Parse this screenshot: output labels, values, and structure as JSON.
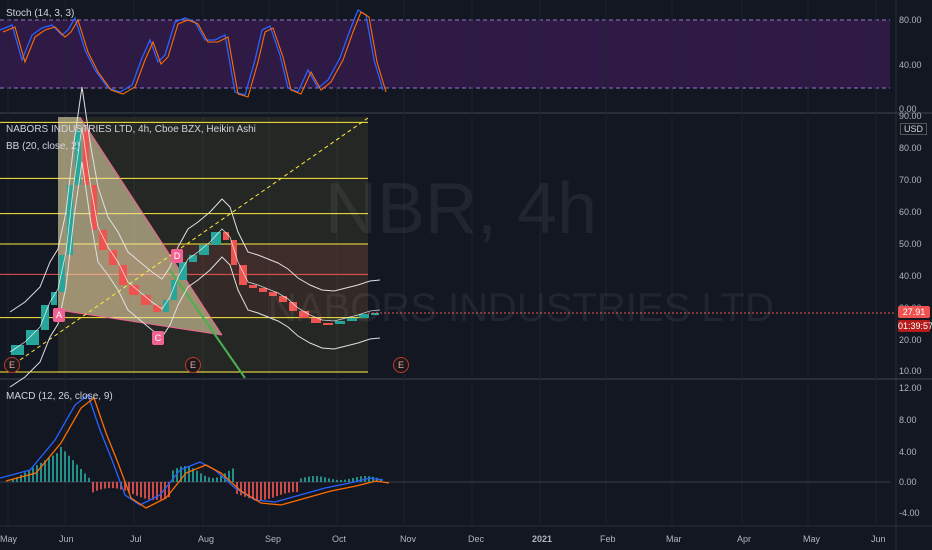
{
  "stoch": {
    "label": "Stoch (14, 3, 3)",
    "axis": [
      "80.00",
      "40.00",
      "0.00"
    ]
  },
  "main": {
    "title": "NABORS INDUSTRIES LTD, 4h, Cboe BZX, Heikin Ashi",
    "bb_label": "BB (20, close, 2)",
    "watermark_symbol": "NBR, 4h",
    "watermark_name": "NABORS INDUSTRIES LTD",
    "currency": "USD",
    "axis": [
      "90.00",
      "80.00",
      "70.00",
      "60.00",
      "50.00",
      "40.00",
      "30.00",
      "20.00",
      "10.00"
    ],
    "last_price": "27.91",
    "countdown": "01:39:57",
    "pattern_points": [
      "A",
      "C",
      "D"
    ],
    "event_markers": [
      "E",
      "E",
      "E"
    ]
  },
  "macd": {
    "label": "MACD (12, 26, close, 9)",
    "axis": [
      "12.00",
      "8.00",
      "4.00",
      "0.00",
      "-4.00"
    ]
  },
  "time_axis": [
    "May",
    "Jun",
    "Jul",
    "Aug",
    "Sep",
    "Oct",
    "Nov",
    "Dec",
    "2021",
    "Feb",
    "Mar",
    "Apr",
    "May",
    "Jun"
  ],
  "colors": {
    "background": "#131722",
    "up_candle": "#26a69a",
    "down_candle": "#ef5350",
    "stoch_k": "#2962ff",
    "stoch_d": "#ff6d00",
    "stoch_band": "#7b1fa2",
    "fib_line": "#ffeb3b",
    "price_tag": "#ef5350",
    "countdown_tag": "#ef5350",
    "pattern_marker": "#f06292"
  }
}
